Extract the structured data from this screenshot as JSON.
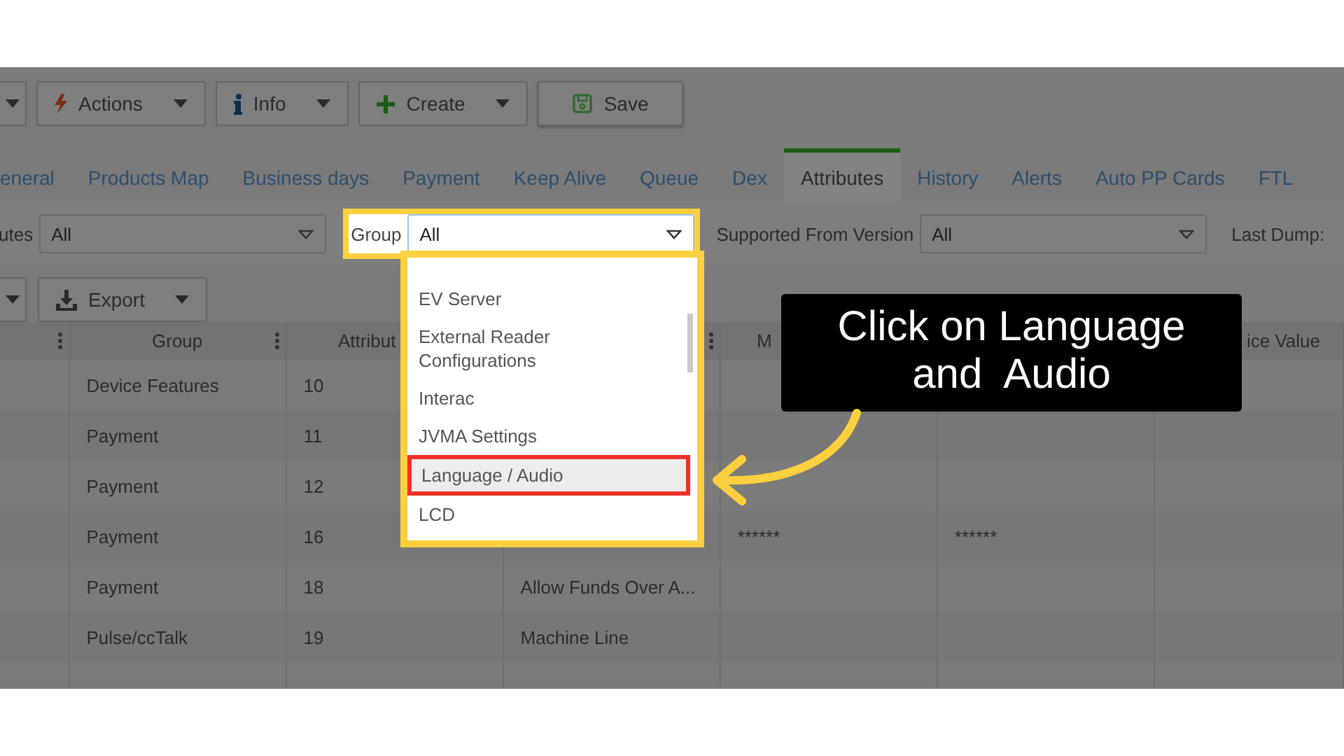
{
  "toolbar": {
    "buttons": [
      {
        "kind": "caret-only"
      },
      {
        "kind": "menu",
        "label": "Actions"
      },
      {
        "kind": "menu",
        "label": "Info"
      },
      {
        "kind": "menu",
        "label": "Create"
      },
      {
        "kind": "plain",
        "label": "Save"
      }
    ]
  },
  "tabs": [
    {
      "label": "eneral",
      "selected": false
    },
    {
      "label": "Products Map",
      "selected": false
    },
    {
      "label": "Business days",
      "selected": false
    },
    {
      "label": "Payment",
      "selected": false
    },
    {
      "label": "Keep Alive",
      "selected": false
    },
    {
      "label": "Queue",
      "selected": false
    },
    {
      "label": "Dex",
      "selected": false
    },
    {
      "label": "Attributes",
      "selected": true
    },
    {
      "label": "History",
      "selected": false
    },
    {
      "label": "Alerts",
      "selected": false
    },
    {
      "label": "Auto PP Cards",
      "selected": false
    },
    {
      "label": "FTL",
      "selected": false
    }
  ],
  "filters": [
    {
      "kind": "select",
      "label": "utes",
      "value": "All",
      "highlighted": false
    },
    {
      "kind": "select",
      "label": "Group",
      "value": "All",
      "highlighted": true
    },
    {
      "kind": "select",
      "label": "Supported From Version",
      "value": "All",
      "highlighted": false
    },
    {
      "kind": "label",
      "label": "Last Dump:"
    }
  ],
  "grid_toolbar": {
    "buttons": [
      {
        "kind": "caret-only"
      },
      {
        "kind": "menu",
        "label": "Export"
      }
    ]
  },
  "table": {
    "columns": [
      {},
      {
        "label": "Group"
      },
      {
        "label": "Attribut"
      },
      {},
      {
        "label": "M"
      },
      {},
      {
        "label": "ice Value"
      }
    ],
    "rows": [
      {
        "group": "Device Features",
        "attribut": "10"
      },
      {
        "group": "Payment",
        "attribut": "11"
      },
      {
        "group": "Payment",
        "attribut": "12"
      },
      {
        "group": "Payment",
        "attribut": "16",
        "column_5": "******",
        "column_6": "******"
      },
      {
        "group": "Payment",
        "attribut": "18",
        "column_4": "Allow Funds Over A..."
      },
      {
        "group": "Pulse/ccTalk",
        "attribut": "19",
        "column_4": "Machine Line"
      },
      {}
    ]
  },
  "dropdown": {
    "items": [
      {
        "label": "EV Server",
        "hovered": false
      },
      {
        "label": "External Reader Configurations",
        "hovered": false
      },
      {
        "label": "Interac",
        "hovered": false
      },
      {
        "label": "JVMA Settings",
        "hovered": false
      },
      {
        "label": "Language / Audio",
        "hovered": true
      },
      {
        "label": "LCD",
        "hovered": false
      }
    ]
  },
  "callout": {
    "text": "Click on Language\nand  Audio"
  }
}
